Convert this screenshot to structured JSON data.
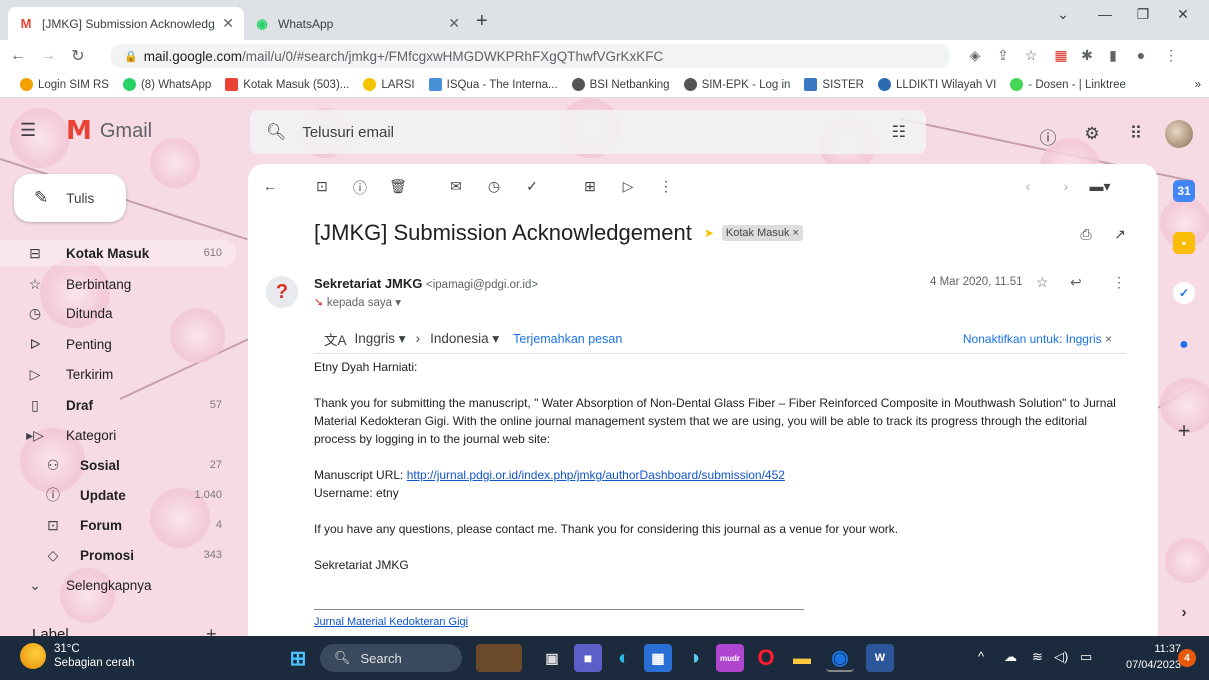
{
  "browser": {
    "tabs": [
      {
        "title": "[JMKG] Submission Acknowledge",
        "icon": "gmail-icon",
        "active": true
      },
      {
        "title": "WhatsApp",
        "icon": "whatsapp-icon",
        "active": false
      }
    ],
    "url_host": "mail.google.com",
    "url_path": "/mail/u/0/#search/jmkg+/FMfcgxwHMGDWKPRhFXgQThwfVGrKxKFC",
    "bookmarks": [
      "Login SIM RS",
      "(8) WhatsApp",
      "Kotak Masuk (503)...",
      "LARSI",
      "ISQua - The Interna...",
      "BSI Netbanking",
      "SIM-EPK - Log in",
      "SISTER",
      "LLDIKTI Wilayah VI",
      "- Dosen - | Linktree"
    ],
    "bookmarks_overflow": "»"
  },
  "gmail": {
    "logo_text": "Gmail",
    "search_placeholder": "Telusuri email",
    "compose_label": "Tulis",
    "nav": [
      {
        "label": "Kotak Masuk",
        "count": "610",
        "icon": "inbox-icon",
        "bold": true
      },
      {
        "label": "Berbintang",
        "count": "",
        "icon": "star-icon",
        "bold": false
      },
      {
        "label": "Ditunda",
        "count": "",
        "icon": "clock-icon",
        "bold": false
      },
      {
        "label": "Penting",
        "count": "",
        "icon": "important-icon",
        "bold": false
      },
      {
        "label": "Terkirim",
        "count": "",
        "icon": "send-icon",
        "bold": false
      },
      {
        "label": "Draf",
        "count": "57",
        "icon": "draft-icon",
        "bold": true
      },
      {
        "label": "Kategori",
        "count": "",
        "icon": "label-icon",
        "bold": false
      },
      {
        "label": "Sosial",
        "count": "27",
        "icon": "people-icon",
        "bold": true
      },
      {
        "label": "Update",
        "count": "1.040",
        "icon": "info-icon",
        "bold": true
      },
      {
        "label": "Forum",
        "count": "4",
        "icon": "forum-icon",
        "bold": true
      },
      {
        "label": "Promosi",
        "count": "343",
        "icon": "tag-icon",
        "bold": true
      },
      {
        "label": "Selengkapnya",
        "count": "",
        "icon": "chevron-down-icon",
        "bold": false
      }
    ],
    "labels_header": "Label",
    "labels_add": "+"
  },
  "message": {
    "subject": "[JMKG] Submission Acknowledgement",
    "label_chip": "Kotak Masuk",
    "sender_name": "Sekretariat JMKG",
    "sender_email": "<ipamagi@pdgi.or.id>",
    "to": "kepada saya",
    "date": "4 Mar 2020, 11.51",
    "translate": {
      "from_lang": "Inggris",
      "to_lang": "Indonesia",
      "translate_link": "Terjemahkan pesan",
      "disable_link": "Nonaktifkan untuk: Inggris"
    },
    "greeting": "Etny Dyah Harniati:",
    "para1": "Thank you for submitting the manuscript, \" Water Absorption of Non-Dental Glass Fiber – Fiber Reinforced Composite in Mouthwash Solution\" to Jurnal Material Kedokteran Gigi. With the online journal management system that we are using, you will be able to track its progress through the editorial process by logging in to the journal web site:",
    "url_label": "Manuscript URL: ",
    "url": "http://jurnal.pdgi.or.id/index.php/jmkg/authorDashboard/submission/452",
    "username": "Username: etny",
    "para2": "If you have any questions, please contact me. Thank you for considering this journal as a venue for your work.",
    "signoff": "Sekretariat JMKG",
    "signature_link": "Jurnal Material Kedokteran Gigi"
  },
  "taskbar": {
    "temperature": "31°C",
    "weather": "Sebagian cerah",
    "search_label": "Search",
    "time": "11:37",
    "date": "07/04/2023",
    "notifications": "4"
  },
  "colors": {
    "accent": "#1a73e8",
    "gmail_red": "#ea4335",
    "taskbar_bg": "#1b2a3c",
    "theme_pink": "#f7dbe4"
  }
}
